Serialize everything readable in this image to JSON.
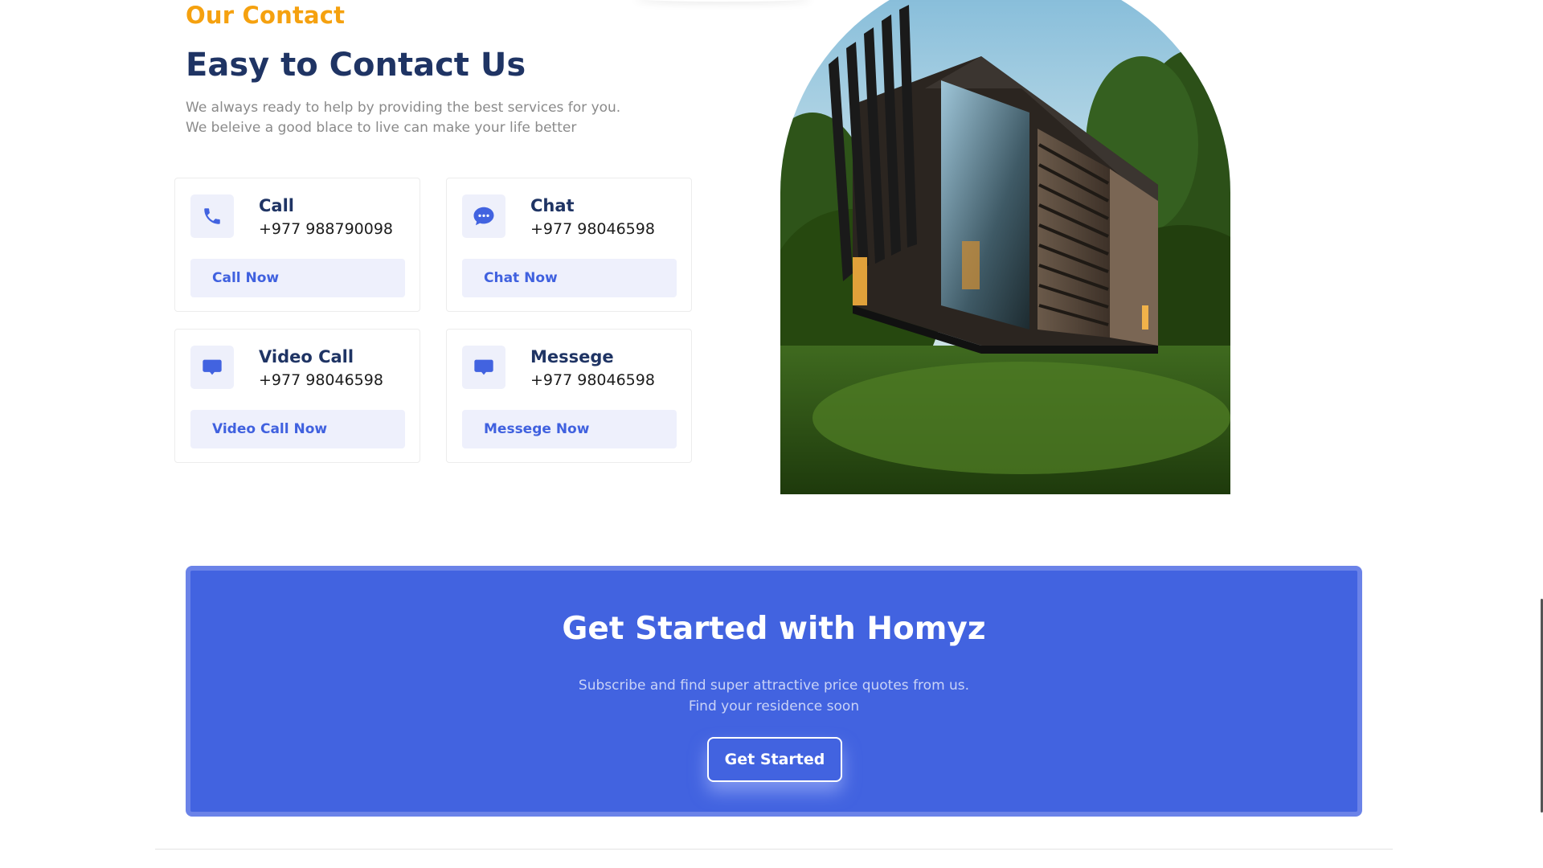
{
  "contact": {
    "eyebrow": "Our Contact",
    "title": "Easy to Contact Us",
    "description_lines": [
      "We always ready to help by providing the best services for you.",
      "We beleive a good blace to live can make your life better"
    ],
    "cards": [
      {
        "icon": "phone-icon",
        "title": "Call",
        "detail": "+977 988790098",
        "button": "Call Now"
      },
      {
        "icon": "chat-bubble-icon",
        "title": "Chat",
        "detail": "+977 98046598",
        "button": "Chat Now"
      },
      {
        "icon": "video-call-icon",
        "title": "Video Call",
        "detail": "+977 98046598",
        "button": "Video Call Now"
      },
      {
        "icon": "message-icon",
        "title": "Messege",
        "detail": "+977 98046598",
        "button": "Messege Now"
      }
    ]
  },
  "banner": {
    "title": "Get Started with Homyz",
    "subtitle_lines": [
      "Subscribe and find super attractive price quotes from us.",
      "Find your residence soon"
    ],
    "button": "Get Started"
  },
  "colors": {
    "accent_orange": "#f5a10f",
    "heading_navy": "#1f3464",
    "primary_blue": "#4263e0",
    "icon_bg": "#eef0fb"
  }
}
